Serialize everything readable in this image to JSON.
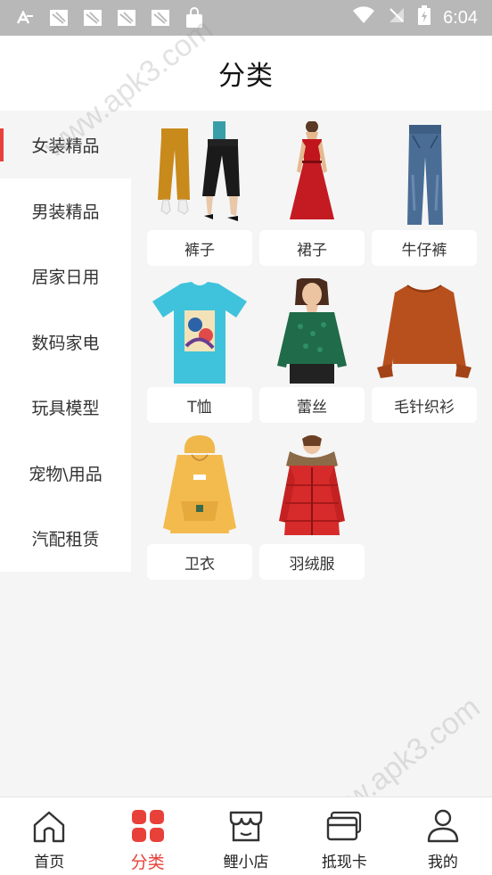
{
  "status_bar": {
    "time": "6:04",
    "icons": [
      "a-icon",
      "notification-icon",
      "notification-icon",
      "notification-icon",
      "notification-icon",
      "shopping-bag-icon",
      "wifi-icon",
      "no-signal-icon",
      "battery-icon"
    ]
  },
  "header": {
    "title": "分类"
  },
  "sidebar": {
    "items": [
      {
        "label": "女装精品",
        "active": true
      },
      {
        "label": "男装精品"
      },
      {
        "label": "居家日用"
      },
      {
        "label": "数码家电"
      },
      {
        "label": "玩具模型"
      },
      {
        "label": "宠物\\用品"
      },
      {
        "label": "汽配租赁"
      }
    ]
  },
  "products": [
    {
      "label": "裤子",
      "icon": "pants-image"
    },
    {
      "label": "裙子",
      "icon": "dress-image"
    },
    {
      "label": "牛仔裤",
      "icon": "jeans-image"
    },
    {
      "label": "T恤",
      "icon": "tshirt-image"
    },
    {
      "label": "蕾丝",
      "icon": "lace-top-image"
    },
    {
      "label": "毛针织衫",
      "icon": "sweater-image"
    },
    {
      "label": "卫衣",
      "icon": "hoodie-image"
    },
    {
      "label": "羽绒服",
      "icon": "down-jacket-image"
    }
  ],
  "bottom_nav": {
    "items": [
      {
        "label": "首页",
        "icon": "home-icon"
      },
      {
        "label": "分类",
        "icon": "category-icon",
        "active": true
      },
      {
        "label": "鲤小店",
        "icon": "shop-icon"
      },
      {
        "label": "抵现卡",
        "icon": "card-icon"
      },
      {
        "label": "我的",
        "icon": "user-icon"
      }
    ]
  },
  "watermark": "www.apk3.com",
  "colors": {
    "accent": "#e8413a",
    "status_bar": "#b8b8b8",
    "background": "#f5f5f5"
  }
}
